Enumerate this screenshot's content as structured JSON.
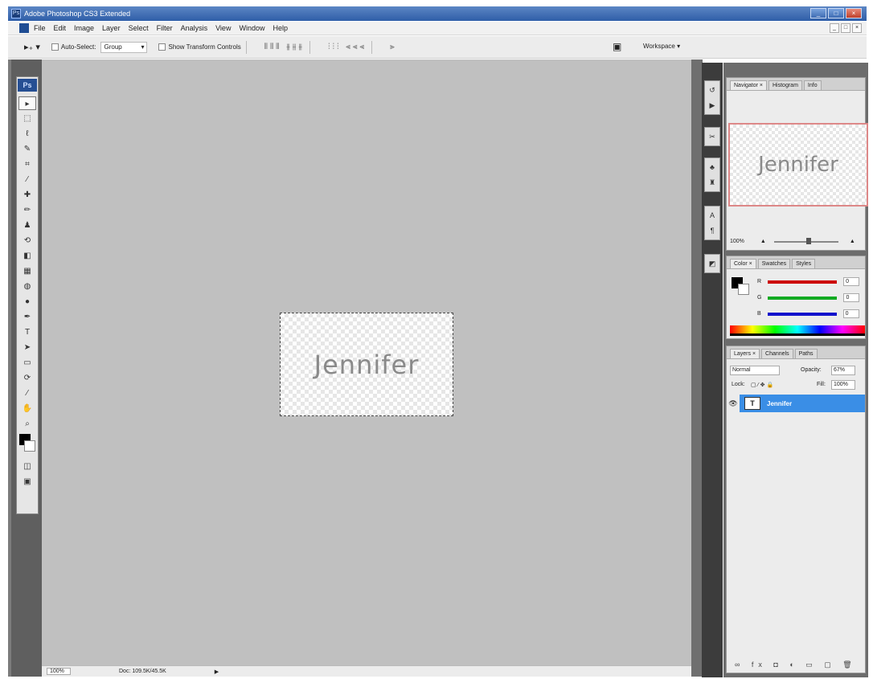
{
  "app": {
    "title": "Adobe Photoshop CS3 Extended",
    "window_buttons": [
      "_",
      "□",
      "×"
    ]
  },
  "menu": {
    "items": [
      "File",
      "Edit",
      "Image",
      "Layer",
      "Select",
      "Filter",
      "Analysis",
      "View",
      "Window",
      "Help"
    ],
    "mdi_buttons": [
      "_",
      "□",
      "×"
    ]
  },
  "options": {
    "auto_select_label": "Auto-Select:",
    "auto_select_value": "Group",
    "show_transform_label": "Show Transform Controls",
    "workspace_label": "Workspace ▾"
  },
  "toolbox": {
    "badge": "Ps",
    "tools": [
      {
        "name": "move-tool-icon",
        "glyph": "▸"
      },
      {
        "name": "marquee-tool-icon",
        "glyph": "⬚"
      },
      {
        "name": "lasso-tool-icon",
        "glyph": "ℓ"
      },
      {
        "name": "magic-wand-tool-icon",
        "glyph": "✎"
      },
      {
        "name": "crop-tool-icon",
        "glyph": "⌗"
      },
      {
        "name": "slice-tool-icon",
        "glyph": "⁄"
      },
      {
        "name": "healing-brush-tool-icon",
        "glyph": "✚"
      },
      {
        "name": "brush-tool-icon",
        "glyph": "✏"
      },
      {
        "name": "clone-stamp-tool-icon",
        "glyph": "♟"
      },
      {
        "name": "history-brush-tool-icon",
        "glyph": "⟲"
      },
      {
        "name": "eraser-tool-icon",
        "glyph": "◧"
      },
      {
        "name": "gradient-tool-icon",
        "glyph": "▦"
      },
      {
        "name": "blur-tool-icon",
        "glyph": "◍"
      },
      {
        "name": "dodge-tool-icon",
        "glyph": "●"
      },
      {
        "name": "pen-tool-icon",
        "glyph": "✒"
      },
      {
        "name": "type-tool-icon",
        "glyph": "T"
      },
      {
        "name": "path-selection-tool-icon",
        "glyph": "➤"
      },
      {
        "name": "shape-tool-icon",
        "glyph": "▭"
      },
      {
        "name": "3d-rotate-tool-icon",
        "glyph": "⟳"
      },
      {
        "name": "eyedropper-tool-icon",
        "glyph": "⁄"
      },
      {
        "name": "hand-tool-icon",
        "glyph": "✋"
      },
      {
        "name": "zoom-tool-icon",
        "glyph": "⌕"
      }
    ],
    "mode_icons": [
      {
        "name": "quick-mask-icon",
        "glyph": "◫"
      },
      {
        "name": "screen-mode-icon",
        "glyph": "▣"
      }
    ]
  },
  "document": {
    "canvas_text": "Jennifer",
    "zoom": "100%",
    "doc_info": "Doc: 109.5K/45.5K",
    "status_arrow": "▶"
  },
  "navigator": {
    "tabs": [
      "Navigator ×",
      "Histogram",
      "Info"
    ],
    "preview_text": "Jennifer",
    "zoom": "100%"
  },
  "color": {
    "tabs": [
      "Color ×",
      "Swatches",
      "Styles"
    ],
    "channels": [
      {
        "label": "R",
        "value": "0",
        "color": "#cc0000"
      },
      {
        "label": "G",
        "value": "0",
        "color": "#11aa22"
      },
      {
        "label": "B",
        "value": "0",
        "color": "#1111cc"
      }
    ]
  },
  "layers": {
    "tabs": [
      "Layers ×",
      "Channels",
      "Paths"
    ],
    "blend_mode": "Normal",
    "opacity_label": "Opacity:",
    "opacity_value": "67%",
    "lock_label": "Lock:",
    "fill_label": "Fill:",
    "fill_value": "100%",
    "layer_name": "Jennifer",
    "layer_thumb": "T",
    "footer_icons": "∞ fx ◘ ◐ ▭ ▢ 🗑"
  }
}
